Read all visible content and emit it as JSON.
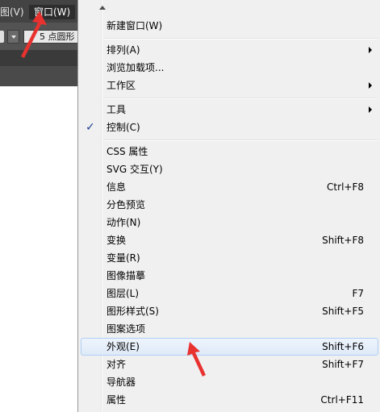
{
  "menubar": {
    "view_label": "图(V)",
    "window_label": "窗口(W)"
  },
  "toolbar": {
    "stroke_profile": "5 点圆形"
  },
  "window_menu": {
    "items": [
      {
        "label": "新建窗口(W)",
        "shortcut": "",
        "submenu": false,
        "checked": false
      },
      {
        "label": "排列(A)",
        "shortcut": "",
        "submenu": true,
        "checked": false
      },
      {
        "label": "浏览加载项...",
        "shortcut": "",
        "submenu": false,
        "checked": false
      },
      {
        "label": "工作区",
        "shortcut": "",
        "submenu": true,
        "checked": false
      },
      {
        "label": "工具",
        "shortcut": "",
        "submenu": true,
        "checked": false
      },
      {
        "label": "控制(C)",
        "shortcut": "",
        "submenu": false,
        "checked": true
      },
      {
        "label": "CSS 属性",
        "shortcut": "",
        "submenu": false,
        "checked": false
      },
      {
        "label": "SVG 交互(Y)",
        "shortcut": "",
        "submenu": false,
        "checked": false
      },
      {
        "label": "信息",
        "shortcut": "Ctrl+F8",
        "submenu": false,
        "checked": false
      },
      {
        "label": "分色预览",
        "shortcut": "",
        "submenu": false,
        "checked": false
      },
      {
        "label": "动作(N)",
        "shortcut": "",
        "submenu": false,
        "checked": false
      },
      {
        "label": "变换",
        "shortcut": "Shift+F8",
        "submenu": false,
        "checked": false
      },
      {
        "label": "变量(R)",
        "shortcut": "",
        "submenu": false,
        "checked": false
      },
      {
        "label": "图像描摹",
        "shortcut": "",
        "submenu": false,
        "checked": false
      },
      {
        "label": "图层(L)",
        "shortcut": "F7",
        "submenu": false,
        "checked": false
      },
      {
        "label": "图形样式(S)",
        "shortcut": "Shift+F5",
        "submenu": false,
        "checked": false
      },
      {
        "label": "图案选项",
        "shortcut": "",
        "submenu": false,
        "checked": false
      },
      {
        "label": "外观(E)",
        "shortcut": "Shift+F6",
        "submenu": false,
        "checked": false,
        "highlighted": true
      },
      {
        "label": "对齐",
        "shortcut": "Shift+F7",
        "submenu": false,
        "checked": false
      },
      {
        "label": "导航器",
        "shortcut": "",
        "submenu": false,
        "checked": false
      },
      {
        "label": "属性",
        "shortcut": "Ctrl+F11",
        "submenu": false,
        "checked": false
      }
    ]
  },
  "icons": {
    "check": "checkmark-icon",
    "submenu": "chevron-right-icon",
    "scroll": "scroll-up-icon",
    "annotation": "red-arrow-icon"
  },
  "colors": {
    "app_chrome": "#434343",
    "menu_bg": "#f0f0f0",
    "highlight_border": "#aecff7",
    "annotation_red": "#e8322f"
  }
}
